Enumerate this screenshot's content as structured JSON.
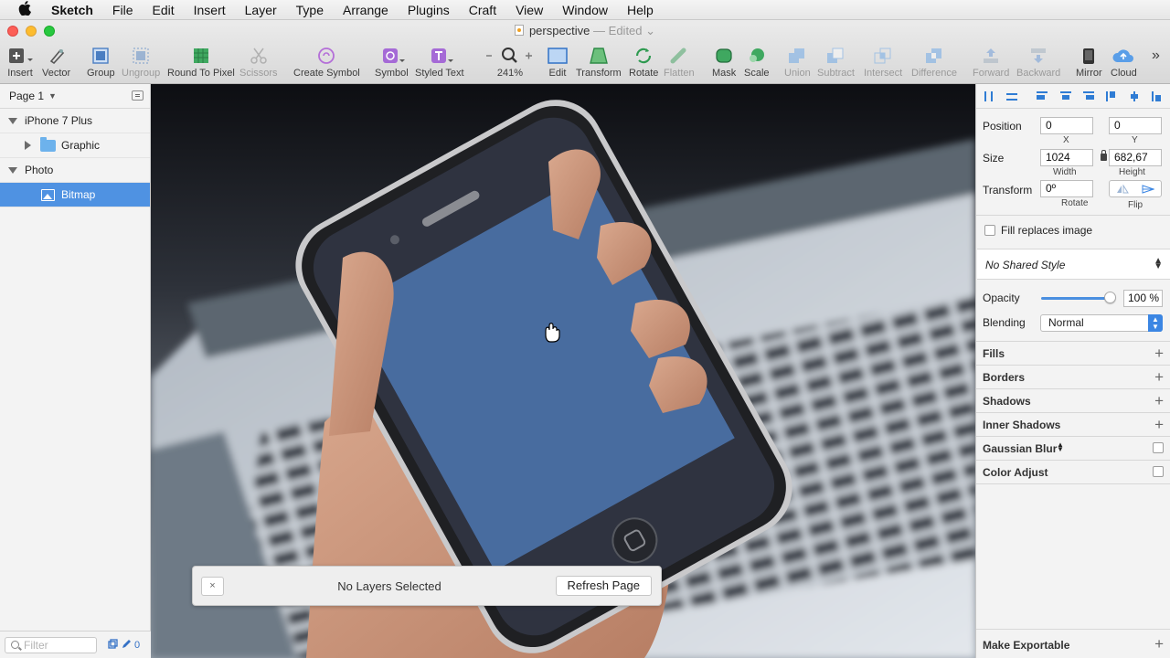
{
  "menubar": {
    "app": "Sketch",
    "items": [
      "File",
      "Edit",
      "Insert",
      "Layer",
      "Type",
      "Arrange",
      "Plugins",
      "Craft",
      "View",
      "Window",
      "Help"
    ]
  },
  "window": {
    "doc_name": "perspective",
    "doc_status": "— Edited"
  },
  "toolbar": {
    "insert": "Insert",
    "vector": "Vector",
    "group": "Group",
    "ungroup": "Ungroup",
    "round_to_pixel": "Round To Pixel",
    "scissors": "Scissors",
    "create_symbol": "Create Symbol",
    "symbol": "Symbol",
    "styled_text": "Styled Text",
    "zoom": "241%",
    "edit": "Edit",
    "transform": "Transform",
    "rotate": "Rotate",
    "flatten": "Flatten",
    "mask": "Mask",
    "scale": "Scale",
    "union": "Union",
    "subtract": "Subtract",
    "intersect": "Intersect",
    "difference": "Difference",
    "forward": "Forward",
    "backward": "Backward",
    "mirror": "Mirror",
    "cloud": "Cloud",
    "more": "»"
  },
  "layers": {
    "page": "Page 1",
    "items": [
      {
        "label": "iPhone 7 Plus"
      },
      {
        "label": "Graphic"
      },
      {
        "label": "Photo"
      },
      {
        "label": "Bitmap"
      }
    ],
    "filter_placeholder": "Filter",
    "edit_count": "0"
  },
  "toast": {
    "close": "×",
    "message": "No Layers Selected",
    "action": "Refresh Page"
  },
  "inspector": {
    "position_label": "Position",
    "x": "0",
    "y": "0",
    "x_label": "X",
    "y_label": "Y",
    "size_label": "Size",
    "width": "1024",
    "height": "682,67",
    "width_label": "Width",
    "height_label": "Height",
    "transform_label": "Transform",
    "rotate": "0º",
    "rotate_label": "Rotate",
    "flip_label": "Flip",
    "fill_replaces": "Fill replaces image",
    "shared_style": "No Shared Style",
    "opacity_label": "Opacity",
    "opacity": "100 %",
    "opacity_level": 1.0,
    "blending_label": "Blending",
    "blending": "Normal",
    "sections": {
      "fills": "Fills",
      "borders": "Borders",
      "shadows": "Shadows",
      "inner_shadows": "Inner Shadows",
      "gaussian_blur": "Gaussian Blur",
      "color_adjust": "Color Adjust"
    },
    "make_exportable": "Make Exportable"
  },
  "colors": {
    "selection": "#4f92e2",
    "accent": "#3b86e3",
    "screen": "#486c9f"
  }
}
